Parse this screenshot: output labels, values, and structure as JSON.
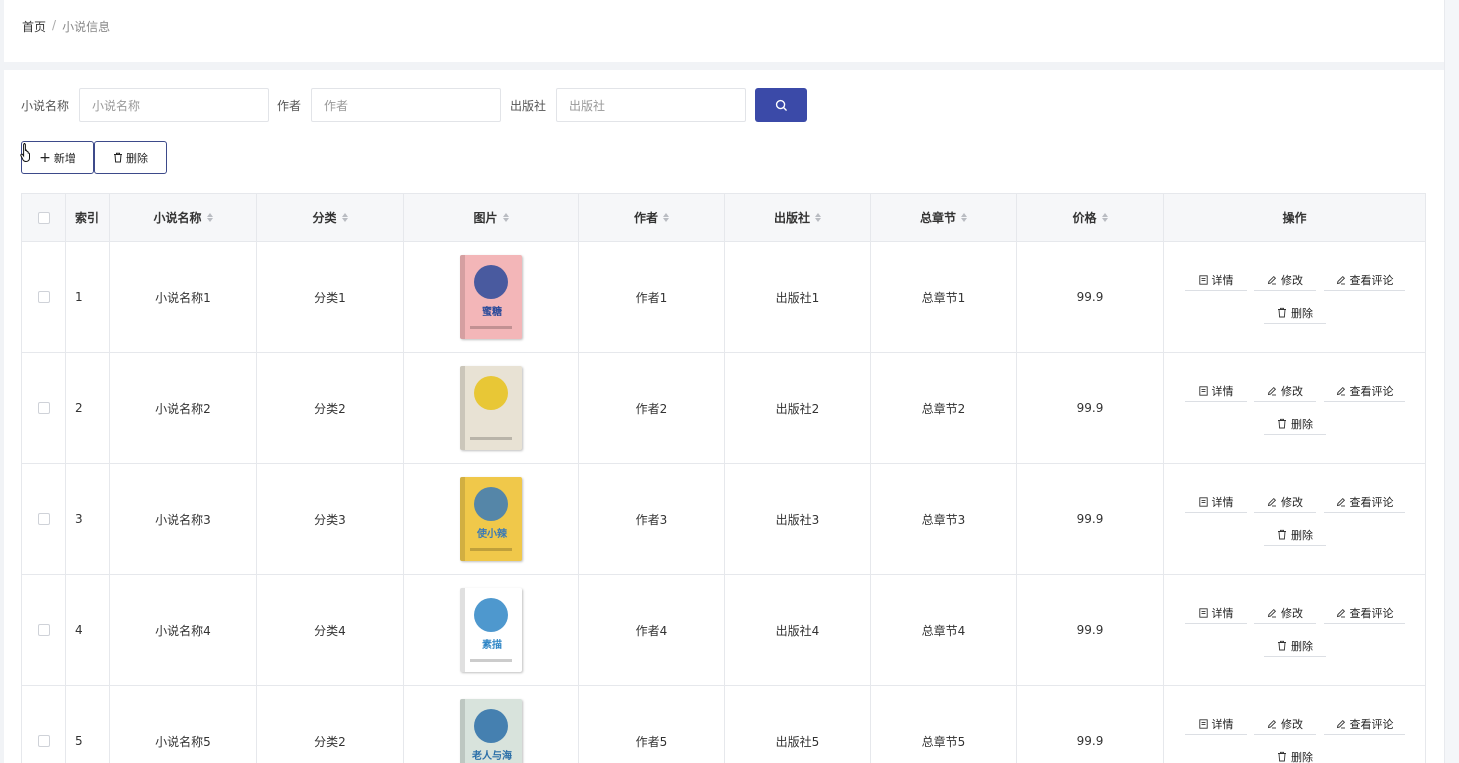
{
  "breadcrumb": {
    "home": "首页",
    "separator": "/",
    "current": "小说信息"
  },
  "search": {
    "name_label": "小说名称",
    "name_placeholder": "小说名称",
    "author_label": "作者",
    "author_placeholder": "作者",
    "publisher_label": "出版社",
    "publisher_placeholder": "出版社",
    "button_icon": "search-icon"
  },
  "actions": {
    "add_label": "新增",
    "delete_label": "删除"
  },
  "table": {
    "headers": [
      "索引",
      "小说名称",
      "分类",
      "图片",
      "作者",
      "出版社",
      "总章节",
      "价格",
      "操作"
    ],
    "rows": [
      {
        "index": "1",
        "name": "小说名称1",
        "category": "分类1",
        "author": "作者1",
        "publisher": "出版社1",
        "chapters": "总章节1",
        "price": "99.9"
      },
      {
        "index": "2",
        "name": "小说名称2",
        "category": "分类2",
        "author": "作者2",
        "publisher": "出版社2",
        "chapters": "总章节2",
        "price": "99.9"
      },
      {
        "index": "3",
        "name": "小说名称3",
        "category": "分类3",
        "author": "作者3",
        "publisher": "出版社3",
        "chapters": "总章节3",
        "price": "99.9"
      },
      {
        "index": "4",
        "name": "小说名称4",
        "category": "分类4",
        "author": "作者4",
        "publisher": "出版社4",
        "chapters": "总章节4",
        "price": "99.9"
      },
      {
        "index": "5",
        "name": "小说名称5",
        "category": "分类2",
        "author": "作者5",
        "publisher": "出版社5",
        "chapters": "总章节5",
        "price": "99.9"
      }
    ],
    "row_actions": {
      "detail": "详情",
      "edit": "修改",
      "comments": "查看评论",
      "delete": "删除"
    }
  },
  "covers": [
    {
      "bg": "#f3b6b8",
      "accent": "#2a4a9a",
      "lettering": "蜜糖"
    },
    {
      "bg": "#e8e2d4",
      "accent": "#e8c21a",
      "lettering": ""
    },
    {
      "bg": "#f0c84a",
      "accent": "#3a7ab8",
      "lettering": "使小辣"
    },
    {
      "bg": "#ffffff",
      "accent": "#2f86c6",
      "lettering": "素描"
    },
    {
      "bg": "#d8e3dc",
      "accent": "#2b6fa8",
      "lettering": "老人与海"
    }
  ],
  "colors": {
    "primary": "#3b4aa8",
    "border": "#e6e8ec",
    "header_bg": "#f6f7f9"
  }
}
